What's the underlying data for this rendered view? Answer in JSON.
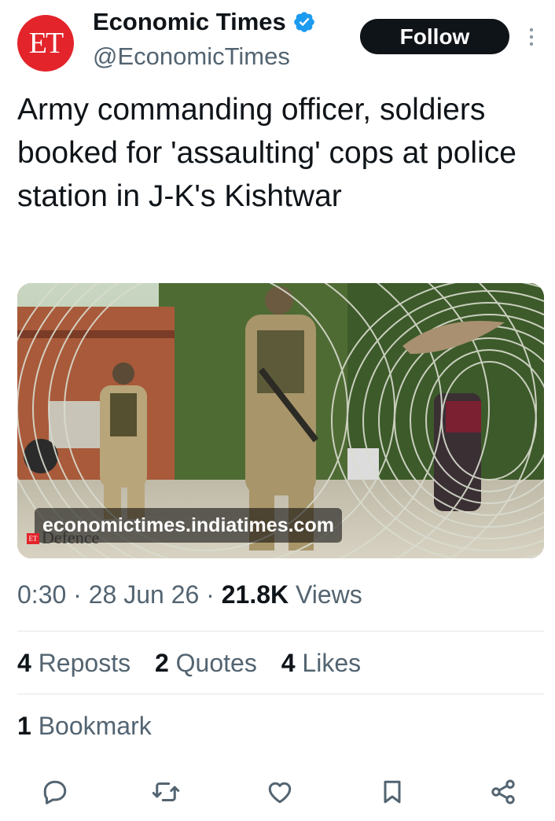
{
  "author": {
    "avatar_text": "ET",
    "name": "Economic Times",
    "handle": "@EconomicTimes",
    "verified": true
  },
  "follow_label": "Follow",
  "tweet_text": "Army commanding officer, soldiers booked for 'assaulting' cops at police station in J-K's Kishtwar",
  "media": {
    "link_domain": "economictimes.indiatimes.com",
    "watermark_logo": "ET",
    "watermark_text": "Defence"
  },
  "meta": {
    "time": "0:30",
    "date": "28 Jun 26",
    "views_count": "21.8K",
    "views_label": "Views"
  },
  "stats": {
    "reposts_count": "4",
    "reposts_label": "Reposts",
    "quotes_count": "2",
    "quotes_label": "Quotes",
    "likes_count": "4",
    "likes_label": "Likes",
    "bookmarks_count": "1",
    "bookmarks_label": "Bookmark"
  },
  "icons": {
    "actions": [
      "reply-icon",
      "repost-icon",
      "like-icon",
      "bookmark-icon",
      "share-icon"
    ]
  },
  "colors": {
    "text": "#0f1419",
    "secondary": "#536471",
    "verified": "#1d9bf0",
    "brand_red": "#e3242b"
  }
}
